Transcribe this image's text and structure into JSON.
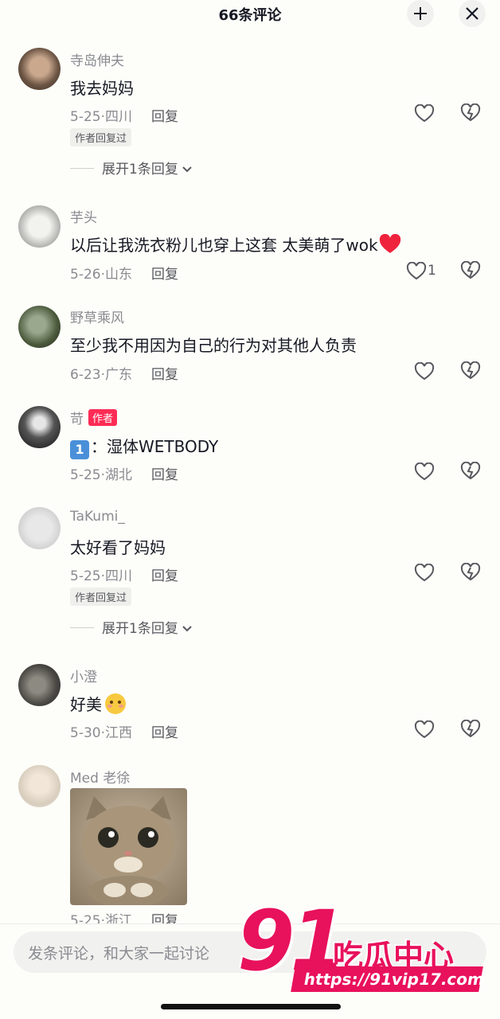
{
  "header": {
    "title": "66条评论"
  },
  "comments": [
    {
      "username": "寺岛伸夫",
      "text": "我去妈妈",
      "date": "5-25",
      "location": "四川",
      "reply": "回复",
      "badge": "作者回复过",
      "expand": "展开1条回复",
      "likes": ""
    },
    {
      "username": "芋头",
      "text": "以后让我洗衣粉儿也穿上这套 太美萌了wok",
      "date": "5-26",
      "location": "山东",
      "reply": "回复",
      "likes": "1"
    },
    {
      "username": "野草乘风",
      "text": "至少我不用因为自己的行为对其他人负责",
      "date": "6-23",
      "location": "广东",
      "reply": "回复",
      "likes": ""
    },
    {
      "username": "苛",
      "author_tag": "作者",
      "text": "：湿体WETBODY",
      "date": "5-25",
      "location": "湖北",
      "reply": "回复",
      "likes": ""
    },
    {
      "username": "TaKumi_",
      "text": "太好看了妈妈",
      "date": "5-25",
      "location": "四川",
      "reply": "回复",
      "badge": "作者回复过",
      "expand": "展开1条回复",
      "likes": ""
    },
    {
      "username": "小澄",
      "text": "好美",
      "date": "5-30",
      "location": "江西",
      "reply": "回复",
      "likes": ""
    },
    {
      "username": "Med 老徐",
      "date": "5-25",
      "location": "浙江",
      "reply": "回复",
      "likes": ""
    }
  ],
  "input": {
    "placeholder": "发条评论，和大家一起讨论"
  },
  "watermark": {
    "number": "91",
    "name": "吃瓜中心",
    "url": "https://91vip17.com"
  },
  "colors": {
    "accent": "#fe2c55",
    "text": "#161823",
    "muted": "#8a8b91",
    "background": "#fdfdf9"
  }
}
